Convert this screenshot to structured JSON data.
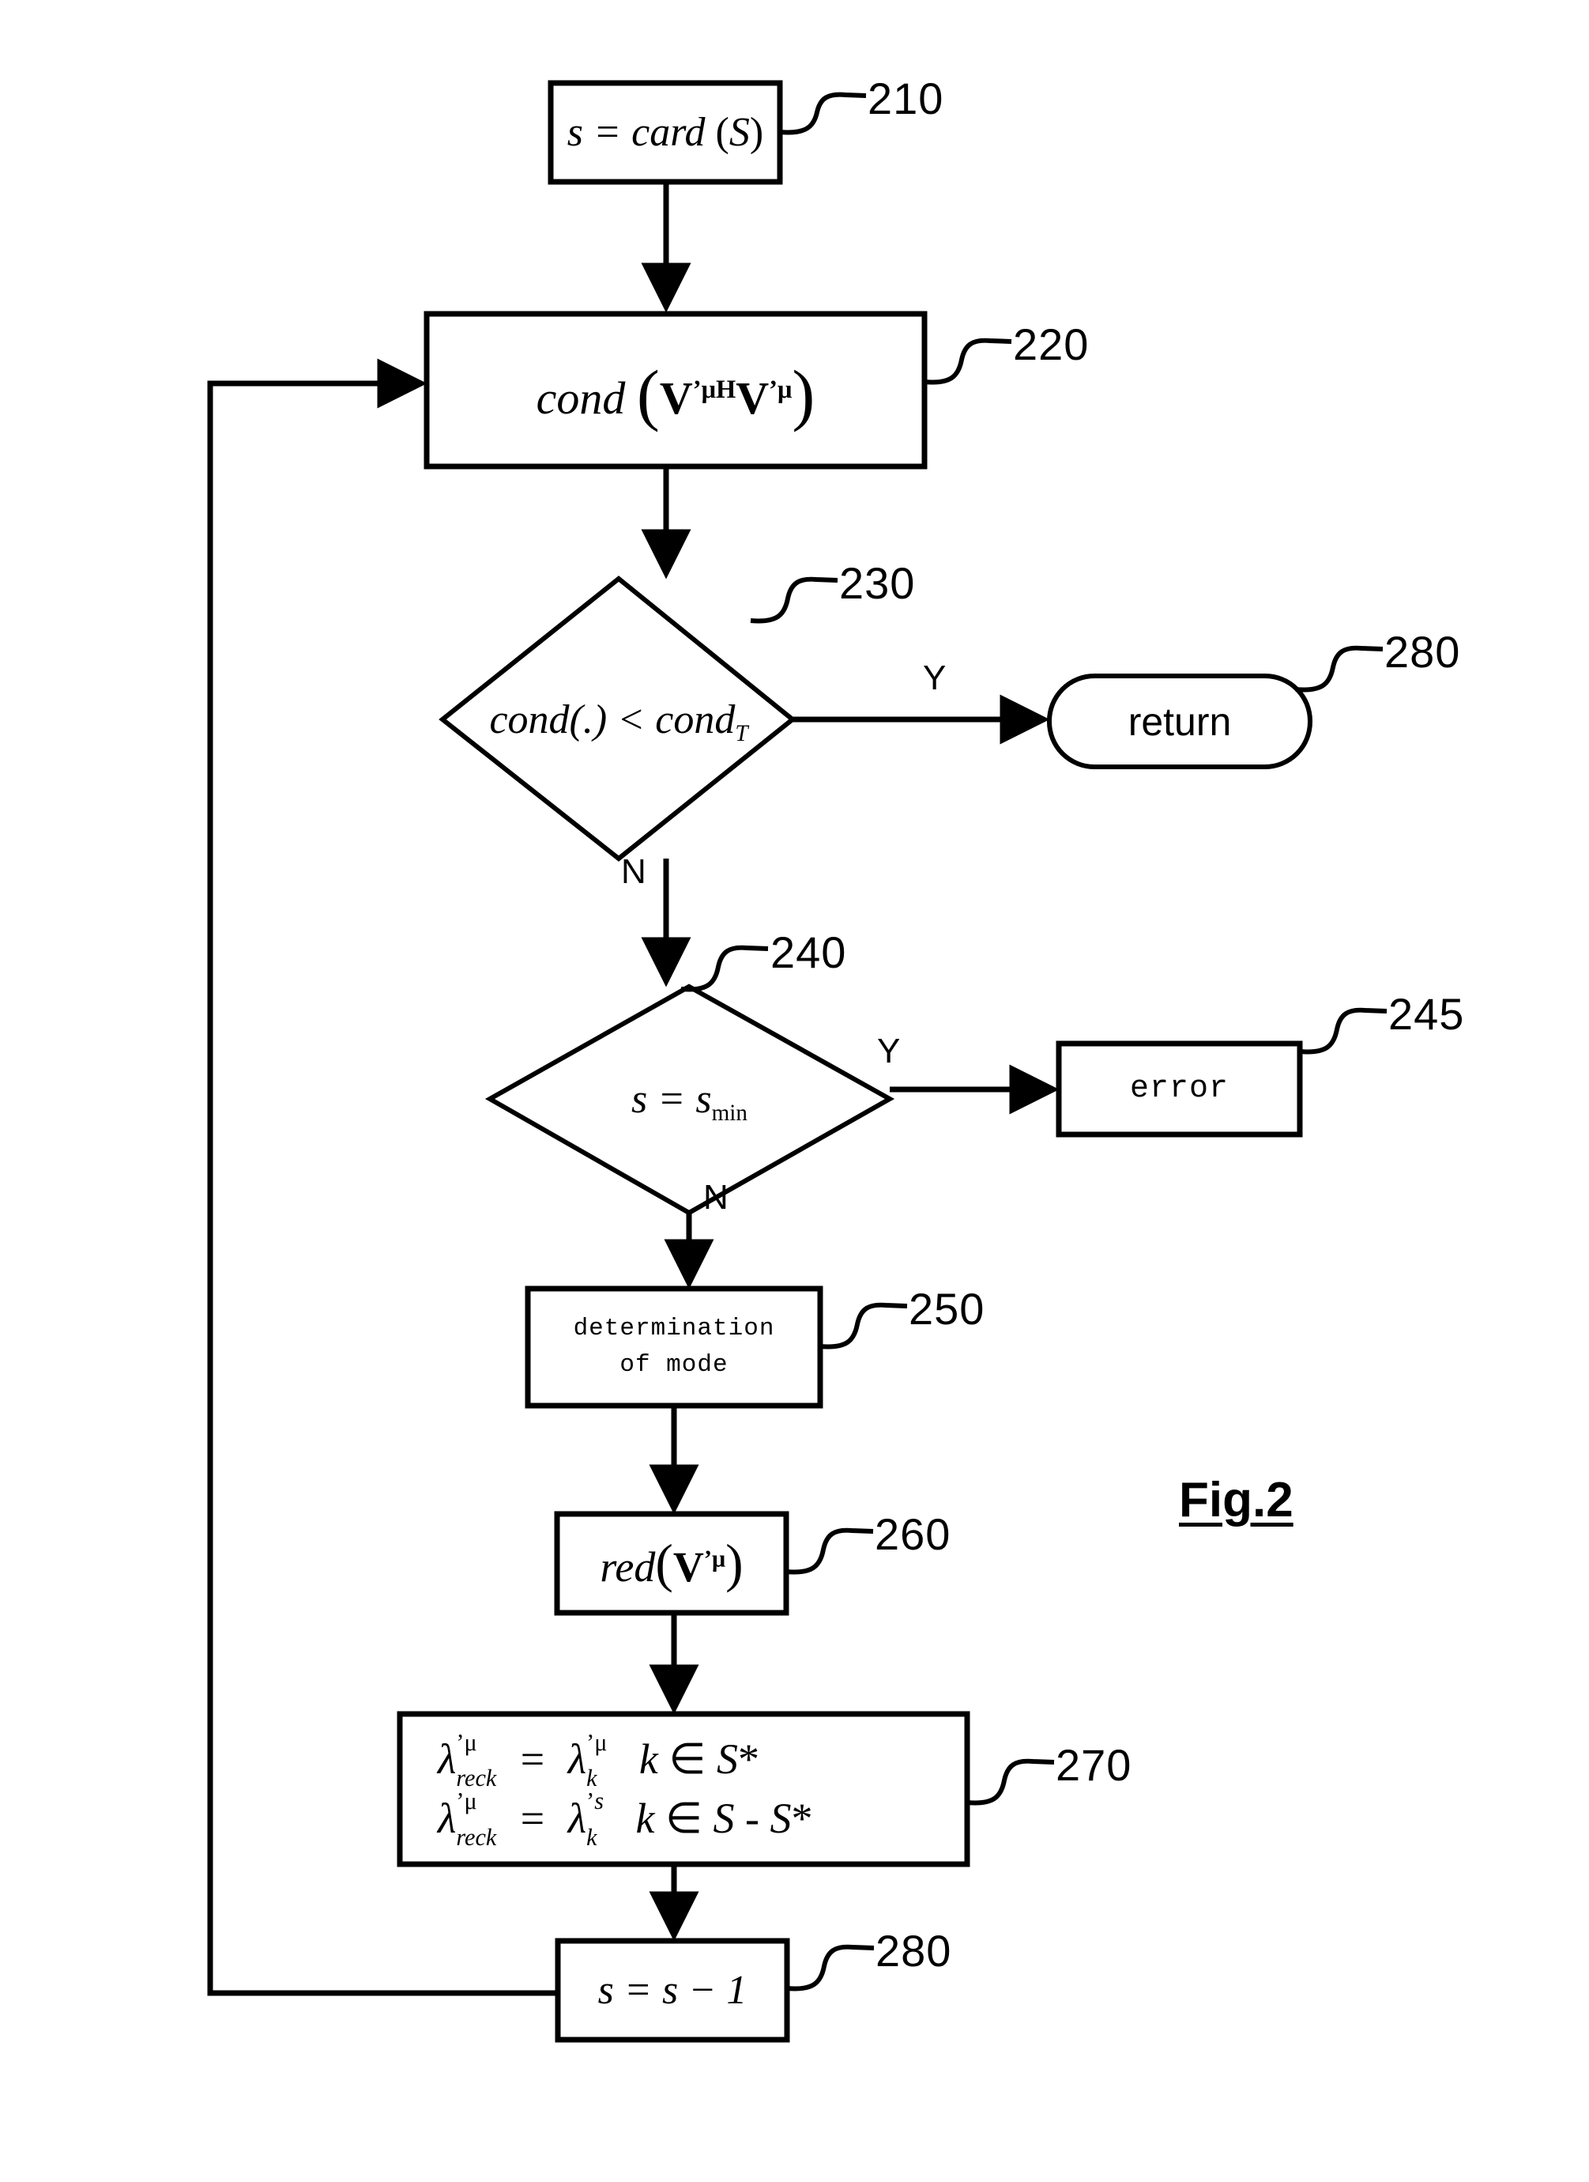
{
  "figure": {
    "caption": "Fig.2"
  },
  "nodes": [
    {
      "id": "210",
      "ref": "210",
      "shape": "process",
      "text": "s = card (S)",
      "name": "node-card-s"
    },
    {
      "id": "220",
      "ref": "220",
      "shape": "process",
      "text": "cond (V'μH V'μ)",
      "name": "node-cond-matrix"
    },
    {
      "id": "230",
      "ref": "230",
      "shape": "decision",
      "text": "cond(.) < condT",
      "name": "node-decision-cond-threshold"
    },
    {
      "id": "280a",
      "ref": "280",
      "shape": "terminator",
      "text": "return",
      "name": "node-return"
    },
    {
      "id": "240",
      "ref": "240",
      "shape": "decision",
      "text": "s = smin",
      "name": "node-decision-s-min"
    },
    {
      "id": "245",
      "ref": "245",
      "shape": "process",
      "text": "error",
      "name": "node-error"
    },
    {
      "id": "250",
      "ref": "250",
      "shape": "process",
      "text": "determination of mode",
      "line1": "determination",
      "line2": "of mode",
      "name": "node-determination-of-mode"
    },
    {
      "id": "260",
      "ref": "260",
      "shape": "process",
      "text": "red(V'μ)",
      "name": "node-reduce-v"
    },
    {
      "id": "270",
      "ref": "270",
      "shape": "process",
      "line1": "λ'μ reck = λ'μ k   k ∈ S*",
      "line2": "λ'μ reck = λ's k   k ∈ S - S*",
      "name": "node-lambda-assignment"
    },
    {
      "id": "280b",
      "ref": "280",
      "shape": "process",
      "text": "s = s − 1",
      "name": "node-decrement-s"
    }
  ],
  "labels": {
    "cond_fn": "cond",
    "red_fn": "red",
    "card_fn": "card",
    "s_var": "s",
    "equals": "=",
    "less_than": "<",
    "dot_arg": "(.)",
    "threshold_sub": "T",
    "min_sub": "min",
    "mu": "μ",
    "hermitian": "H",
    "prime": "'",
    "lambda": "λ",
    "reck_sub": "reck",
    "k_sub": "k",
    "s_sub": "s",
    "in_set": "∈",
    "set_S": "S",
    "set_S_star": "S*",
    "set_diff": "S - S*",
    "bold_V": "V",
    "minus_one": "− 1",
    "paren_open": "(",
    "paren_close": ")",
    "card_arg": "(S)"
  },
  "branches": [
    {
      "from": "230",
      "label": "Y",
      "target": "280a",
      "name": "branch-230-yes"
    },
    {
      "from": "230",
      "label": "N",
      "target": "240",
      "name": "branch-230-no"
    },
    {
      "from": "240",
      "label": "Y",
      "target": "245",
      "name": "branch-240-yes"
    },
    {
      "from": "240",
      "label": "N",
      "target": "250",
      "name": "branch-240-no"
    }
  ],
  "refs": {
    "r210": "210",
    "r220": "220",
    "r230": "230",
    "r240": "240",
    "r245": "245",
    "r250": "250",
    "r260": "260",
    "r270": "270",
    "r280top": "280",
    "r280bottom": "280"
  },
  "colors": {
    "stroke": "#000000",
    "background": "#ffffff"
  }
}
